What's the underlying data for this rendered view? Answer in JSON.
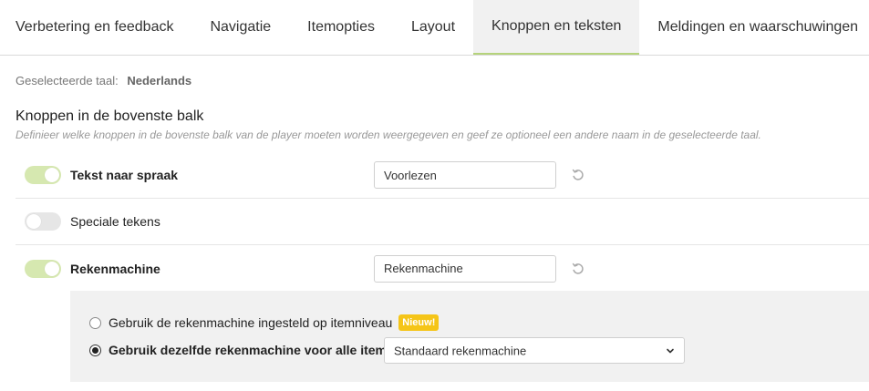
{
  "tabs": [
    {
      "label": "Verbetering en feedback",
      "active": false
    },
    {
      "label": "Navigatie",
      "active": false
    },
    {
      "label": "Itemopties",
      "active": false
    },
    {
      "label": "Layout",
      "active": false
    },
    {
      "label": "Knoppen en teksten",
      "active": true
    },
    {
      "label": "Meldingen en waarschuwingen",
      "active": false
    }
  ],
  "language": {
    "label": "Geselecteerde taal:",
    "value": "Nederlands"
  },
  "section": {
    "title": "Knoppen in de bovenste balk",
    "description": "Definieer welke knoppen in de bovenste balk van de player moeten worden weergegeven en geef ze optioneel een andere naam in de geselecteerde taal."
  },
  "buttons": [
    {
      "label": "Tekst naar spraak",
      "enabled": true,
      "custom_name": "Voorlezen",
      "reset_icon": "reset-icon"
    },
    {
      "label": "Speciale tekens",
      "enabled": false
    },
    {
      "label": "Rekenmachine",
      "enabled": true,
      "custom_name": "Rekenmachine",
      "reset_icon": "reset-icon"
    }
  ],
  "calculator_options": {
    "option_item_level": {
      "label": "Gebruik de rekenmachine ingesteld op itemniveau",
      "selected": false,
      "badge": "Nieuw!"
    },
    "option_all_items": {
      "label": "Gebruik dezelfde rekenmachine voor alle items",
      "selected": true
    },
    "calculator_select": {
      "value": "Standaard rekenmachine",
      "icon": "chevron-down-icon"
    }
  },
  "colors": {
    "accent_green": "#b5d37b",
    "toggle_on": "#d6e8b0",
    "badge_yellow": "#f5c518",
    "panel_bg": "#f1f1f1"
  }
}
